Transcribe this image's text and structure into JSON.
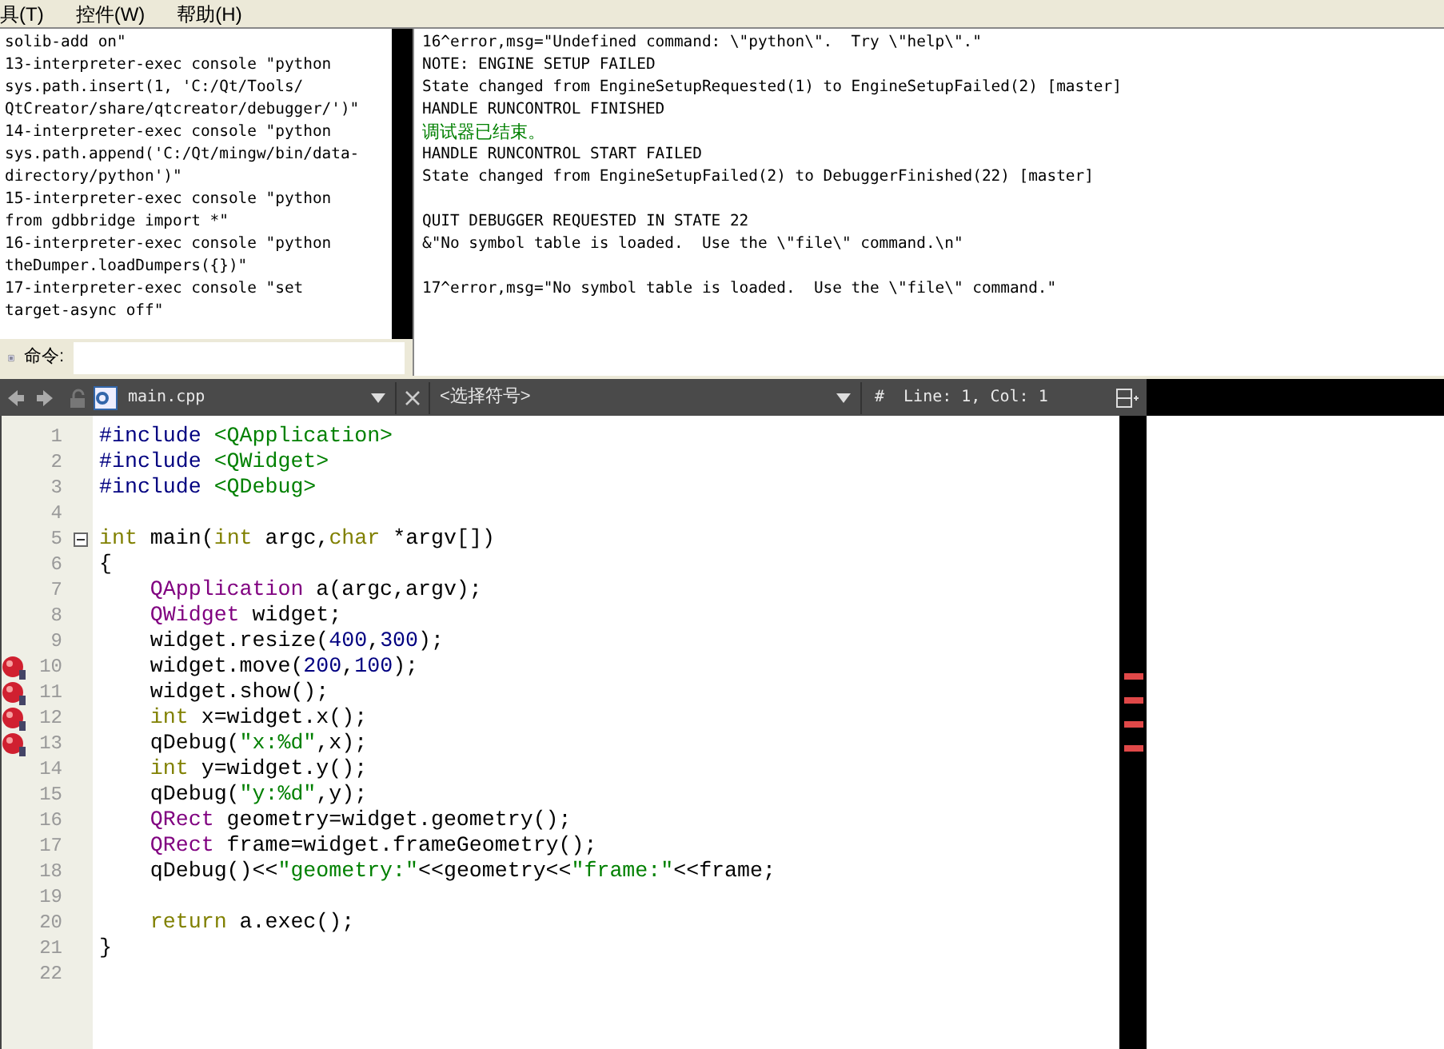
{
  "menu_bar": [
    {
      "label": "具(T)"
    },
    {
      "label": "控件(W)"
    },
    {
      "label": "帮助(H)"
    }
  ],
  "command_log": [
    "solib-add on\"",
    "13-interpreter-exec console \"python",
    "sys.path.insert(1, 'C:/Qt/Tools/",
    "QtCreator/share/qtcreator/debugger/')\"",
    "14-interpreter-exec console \"python",
    "sys.path.append('C:/Qt/mingw/bin/data-",
    "directory/python')\"",
    "15-interpreter-exec console \"python",
    "from gdbbridge import *\"",
    "16-interpreter-exec console \"python",
    "theDumper.loadDumpers({})\"",
    "17-interpreter-exec console \"set",
    "target-async off\""
  ],
  "command_label": "命令:",
  "debugger_log": [
    {
      "kind": "normal",
      "text": "16^error,msg=\"Undefined command: \\\"python\\\".  Try \\\"help\\\".\""
    },
    {
      "kind": "normal",
      "text": "NOTE: ENGINE SETUP FAILED"
    },
    {
      "kind": "normal",
      "text": "State changed from EngineSetupRequested(1) to EngineSetupFailed(2) [master]"
    },
    {
      "kind": "normal",
      "text": "HANDLE RUNCONTROL FINISHED"
    },
    {
      "kind": "status",
      "text": "调试器已结束。"
    },
    {
      "kind": "normal",
      "text": "HANDLE RUNCONTROL START FAILED"
    },
    {
      "kind": "normal",
      "text": "State changed from EngineSetupFailed(2) to DebuggerFinished(22) [master]"
    },
    {
      "kind": "blank"
    },
    {
      "kind": "normal",
      "text": "QUIT DEBUGGER REQUESTED IN STATE 22"
    },
    {
      "kind": "normal",
      "text": "&\"No symbol table is loaded.  Use the \\\"file\\\" command.\\n\""
    },
    {
      "kind": "blank"
    },
    {
      "kind": "normal",
      "text": "17^error,msg=\"No symbol table is loaded.  Use the \\\"file\\\" command.\""
    }
  ],
  "editor_toolbar": {
    "file": "main.cpp",
    "symbol": "<选择符号>",
    "hash": "#",
    "position": "Line: 1, Col: 1"
  },
  "code_lines": [
    {
      "number": "1",
      "breakpoint": false,
      "foldable": false,
      "tokens": [
        {
          "kind": "pre",
          "text": "#include "
        },
        {
          "kind": "str",
          "text": "<QApplication>"
        }
      ]
    },
    {
      "number": "2",
      "breakpoint": false,
      "foldable": false,
      "tokens": [
        {
          "kind": "pre",
          "text": "#include "
        },
        {
          "kind": "str",
          "text": "<QWidget>"
        }
      ]
    },
    {
      "number": "3",
      "breakpoint": false,
      "foldable": false,
      "tokens": [
        {
          "kind": "pre",
          "text": "#include "
        },
        {
          "kind": "str",
          "text": "<QDebug>"
        }
      ]
    },
    {
      "number": "4",
      "breakpoint": false,
      "foldable": false
    },
    {
      "number": "5",
      "breakpoint": false,
      "foldable": true,
      "tokens": [
        {
          "kind": "kw",
          "text": "int"
        },
        {
          "kind": "plain",
          "text": " main("
        },
        {
          "kind": "kw",
          "text": "int"
        },
        {
          "kind": "plain",
          "text": " argc,"
        },
        {
          "kind": "kw",
          "text": "char"
        },
        {
          "kind": "plain",
          "text": " *argv[])"
        }
      ]
    },
    {
      "number": "6",
      "breakpoint": false,
      "foldable": false,
      "tokens": [
        {
          "kind": "plain",
          "text": "{"
        }
      ]
    },
    {
      "number": "7",
      "breakpoint": false,
      "foldable": false,
      "tokens": [
        {
          "kind": "type",
          "text": "    QApplication"
        },
        {
          "kind": "plain",
          "text": " a(argc,argv);"
        }
      ]
    },
    {
      "number": "8",
      "breakpoint": false,
      "foldable": false,
      "tokens": [
        {
          "kind": "type",
          "text": "    QWidget"
        },
        {
          "kind": "plain",
          "text": " widget;"
        }
      ]
    },
    {
      "number": "9",
      "breakpoint": false,
      "foldable": false,
      "tokens": [
        {
          "kind": "plain",
          "text": "    widget.resize("
        },
        {
          "kind": "num",
          "text": "400"
        },
        {
          "kind": "plain",
          "text": ","
        },
        {
          "kind": "num",
          "text": "300"
        },
        {
          "kind": "plain",
          "text": ");"
        }
      ]
    },
    {
      "number": "10",
      "breakpoint": true,
      "foldable": false,
      "tokens": [
        {
          "kind": "plain",
          "text": "    widget.move("
        },
        {
          "kind": "num",
          "text": "200"
        },
        {
          "kind": "plain",
          "text": ","
        },
        {
          "kind": "num",
          "text": "100"
        },
        {
          "kind": "plain",
          "text": ");"
        }
      ]
    },
    {
      "number": "11",
      "breakpoint": true,
      "foldable": false,
      "tokens": [
        {
          "kind": "plain",
          "text": "    widget.show();"
        }
      ]
    },
    {
      "number": "12",
      "breakpoint": true,
      "foldable": false,
      "tokens": [
        {
          "kind": "kw",
          "text": "    int"
        },
        {
          "kind": "plain",
          "text": " x=widget.x();"
        }
      ]
    },
    {
      "number": "13",
      "breakpoint": true,
      "foldable": false,
      "tokens": [
        {
          "kind": "plain",
          "text": "    qDebug("
        },
        {
          "kind": "str",
          "text": "\"x:%d\""
        },
        {
          "kind": "plain",
          "text": ",x);"
        }
      ]
    },
    {
      "number": "14",
      "breakpoint": false,
      "foldable": false,
      "tokens": [
        {
          "kind": "kw",
          "text": "    int"
        },
        {
          "kind": "plain",
          "text": " y=widget.y();"
        }
      ]
    },
    {
      "number": "15",
      "breakpoint": false,
      "foldable": false,
      "tokens": [
        {
          "kind": "plain",
          "text": "    qDebug("
        },
        {
          "kind": "str",
          "text": "\"y:%d\""
        },
        {
          "kind": "plain",
          "text": ",y);"
        }
      ]
    },
    {
      "number": "16",
      "breakpoint": false,
      "foldable": false,
      "tokens": [
        {
          "kind": "type",
          "text": "    QRect"
        },
        {
          "kind": "plain",
          "text": " geometry=widget.geometry();"
        }
      ]
    },
    {
      "number": "17",
      "breakpoint": false,
      "foldable": false,
      "tokens": [
        {
          "kind": "type",
          "text": "    QRect"
        },
        {
          "kind": "plain",
          "text": " frame=widget.frameGeometry();"
        }
      ]
    },
    {
      "number": "18",
      "breakpoint": false,
      "foldable": false,
      "tokens": [
        {
          "kind": "plain",
          "text": "    qDebug()<<"
        },
        {
          "kind": "str",
          "text": "\"geometry:\""
        },
        {
          "kind": "plain",
          "text": "<<geometry<<"
        },
        {
          "kind": "str",
          "text": "\"frame:\""
        },
        {
          "kind": "plain",
          "text": "<<frame;"
        }
      ]
    },
    {
      "number": "19",
      "breakpoint": false,
      "foldable": false
    },
    {
      "number": "20",
      "breakpoint": false,
      "foldable": false,
      "tokens": [
        {
          "kind": "kw",
          "text": "    return"
        },
        {
          "kind": "plain",
          "text": " a.exec();"
        }
      ]
    },
    {
      "number": "21",
      "breakpoint": false,
      "foldable": false,
      "tokens": [
        {
          "kind": "plain",
          "text": "}"
        }
      ]
    },
    {
      "number": "22",
      "breakpoint": false,
      "foldable": false
    }
  ]
}
